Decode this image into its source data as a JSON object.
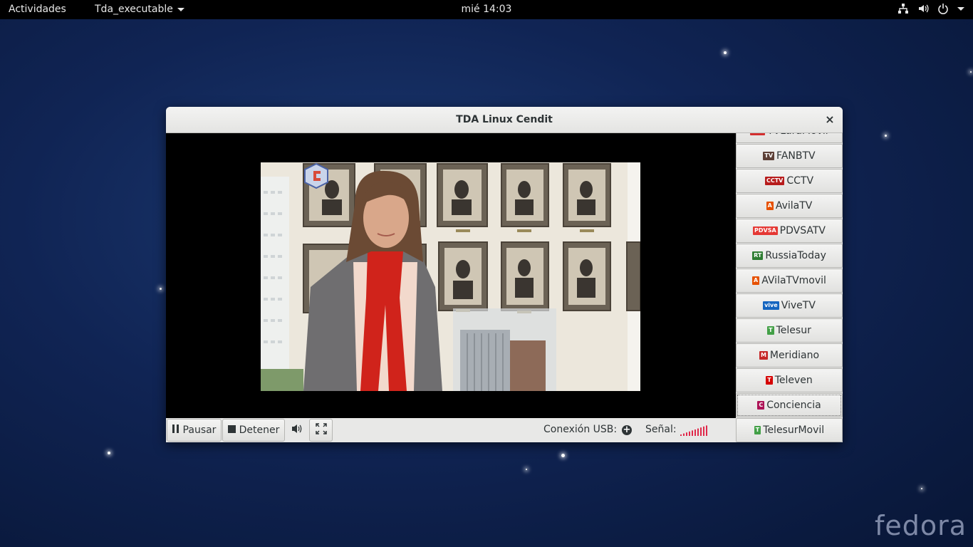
{
  "topbar": {
    "activities": "Actividades",
    "app_menu": "Tda_executable",
    "clock": "mié 14:03"
  },
  "window": {
    "title": "TDA Linux Cendit",
    "close_glyph": "×"
  },
  "controls": {
    "pause_label": "Pausar",
    "stop_label": "Detener",
    "usb_label": "Conexión USB:",
    "signal_label": "Señal:",
    "signal_color": "#e0284a"
  },
  "channels": [
    {
      "label": "TVLaraMovil",
      "logo": "TVL",
      "color": "#d32f2f"
    },
    {
      "label": "FANBTV",
      "logo": "TV",
      "color": "#5d4037"
    },
    {
      "label": "CCTV",
      "logo": "CCTV",
      "color": "#b71c1c"
    },
    {
      "label": "AvilaTV",
      "logo": "A",
      "color": "#e65100"
    },
    {
      "label": "PDVSATV",
      "logo": "PDVSA",
      "color": "#e53935"
    },
    {
      "label": "RussiaToday",
      "logo": "RT",
      "color": "#2e7d32"
    },
    {
      "label": "AVilaTVmovil",
      "logo": "A",
      "color": "#e65100"
    },
    {
      "label": "ViveTV",
      "logo": "vive",
      "color": "#1565c0"
    },
    {
      "label": "Telesur",
      "logo": "T",
      "color": "#43a047"
    },
    {
      "label": "Meridiano",
      "logo": "M",
      "color": "#c62828"
    },
    {
      "label": "Televen",
      "logo": "T",
      "color": "#d50000"
    },
    {
      "label": "Conciencia",
      "logo": "C",
      "color": "#ad1457"
    },
    {
      "label": "TelesurMovil",
      "logo": "T",
      "color": "#43a047"
    }
  ],
  "branding": {
    "wallpaper_logo": "fedora"
  },
  "icons": [
    "network-icon",
    "volume-icon",
    "power-icon",
    "pause-icon",
    "stop-icon",
    "speaker-icon",
    "fullscreen-icon",
    "usb-add-icon",
    "signal-bars-icon"
  ]
}
